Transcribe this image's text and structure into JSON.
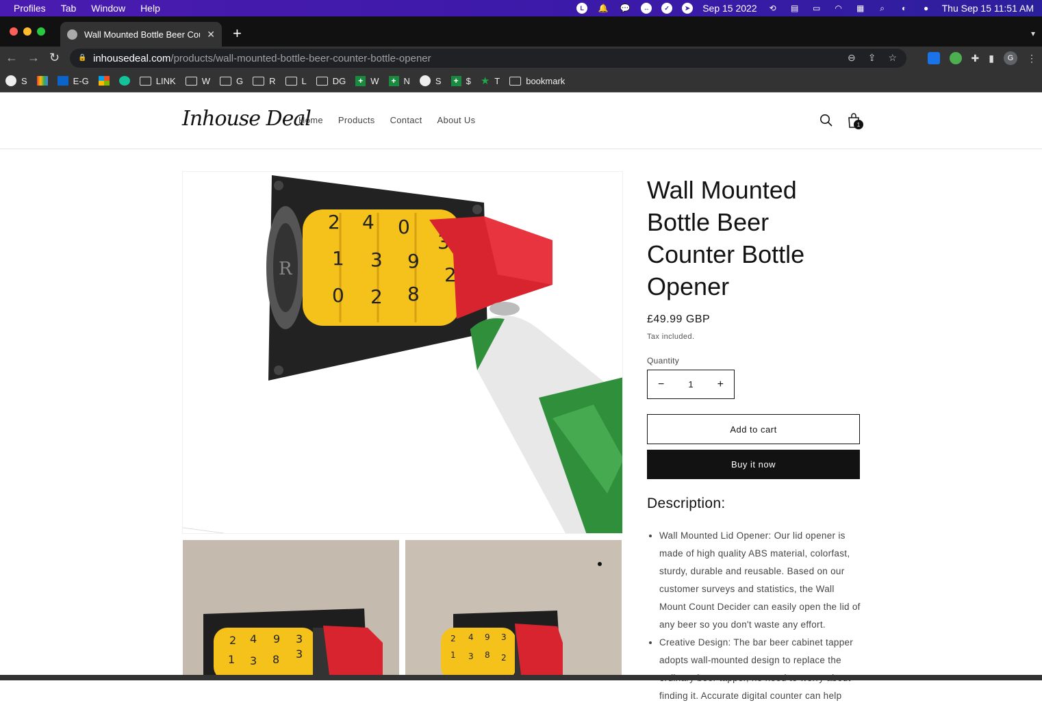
{
  "menubar": {
    "items": [
      "Profiles",
      "Tab",
      "Window",
      "Help"
    ],
    "date_short": "Sep 15 2022",
    "clock": "Thu Sep 15  11:51 AM"
  },
  "browser": {
    "tab_title": "Wall Mounted Bottle Beer Counter Bottle Opener",
    "tab_close": "✕",
    "new_tab": "+",
    "url_host": "inhousedeal.com",
    "url_path": "/products/wall-mounted-bottle-beer-counter-bottle-opener",
    "profile_initial": "G",
    "bookmarks": [
      {
        "label": "S",
        "icon": "globe-icon"
      },
      {
        "label": "",
        "icon": "gmail-icon"
      },
      {
        "label": "E-G",
        "icon": "outlook-icon"
      },
      {
        "label": "",
        "icon": "microsoft-icon"
      },
      {
        "label": "",
        "icon": "grammarly-icon"
      },
      {
        "label": "LINK",
        "icon": "folder-icon"
      },
      {
        "label": "W",
        "icon": "folder-icon"
      },
      {
        "label": "G",
        "icon": "folder-icon"
      },
      {
        "label": "R",
        "icon": "folder-icon"
      },
      {
        "label": "L",
        "icon": "folder-icon"
      },
      {
        "label": "DG",
        "icon": "folder-icon"
      },
      {
        "label": "W",
        "icon": "plus-icon"
      },
      {
        "label": "N",
        "icon": "plus-icon"
      },
      {
        "label": "S",
        "icon": "globe-icon"
      },
      {
        "label": "$",
        "icon": "plus-icon"
      },
      {
        "label": "T",
        "icon": "star-icon"
      },
      {
        "label": "bookmark",
        "icon": "folder-icon"
      }
    ]
  },
  "site": {
    "logo": "Inhouse Deal",
    "nav": [
      "Home",
      "Products",
      "Contact",
      "About Us"
    ],
    "cart_count": "1"
  },
  "product": {
    "title": "Wall Mounted Bottle Beer Counter Bottle Opener",
    "price": "£49.99 GBP",
    "tax_note": "Tax included.",
    "quantity_label": "Quantity",
    "quantity_value": "1",
    "minus": "−",
    "plus": "+",
    "add_to_cart": "Add to cart",
    "buy_now": "Buy it now",
    "description_heading": "Description:",
    "description_items": [
      "Wall Mounted Lid Opener: Our lid opener is made of high quality ABS material, colorfast, sturdy, durable and reusable. Based on our customer surveys and statistics, the Wall Mount Count Decider can easily open the lid of any beer so you don't waste any effort.",
      "Creative Design: The bar beer cabinet tapper adopts wall-mounted design to replace the ordinary beer tapper, no need to worry about finding it. Accurate digital counter can help"
    ],
    "counter_digits": [
      "2",
      "4",
      "0",
      "3",
      "1",
      "3",
      "9",
      "2",
      "0",
      "2",
      "8"
    ],
    "thumb1_digits": [
      "2",
      "4",
      "9",
      "3",
      "1",
      "3",
      "8",
      "3"
    ],
    "thumb2_digits": [
      "2",
      "4",
      "9",
      "3",
      "1",
      "3",
      "8",
      "2"
    ]
  },
  "colors": {
    "menubar": "#3b1aa8",
    "counter_yellow": "#f5c21b",
    "cap_red": "#d8242f",
    "bottle_green": "#2f8f3a",
    "button_dark": "#121212"
  }
}
